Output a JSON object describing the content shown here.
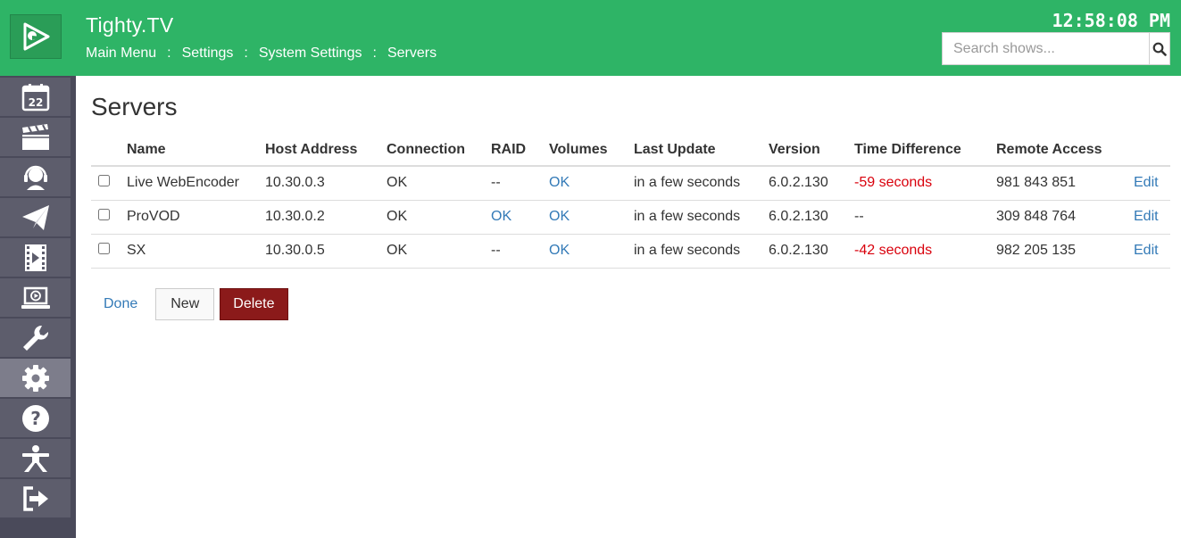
{
  "header": {
    "app_title": "Tighty.TV",
    "clock": "12:58:08 PM",
    "breadcrumb": [
      "Main Menu",
      "Settings",
      "System Settings",
      "Servers"
    ],
    "breadcrumb_separator": ":",
    "search_placeholder": "Search shows..."
  },
  "sidebar": {
    "calendar_day": "22",
    "icons": [
      "calendar-icon",
      "clapperboard-icon",
      "headset-icon",
      "paper-plane-icon",
      "film-icon",
      "laptop-play-icon",
      "wrench-icon",
      "gear-icon",
      "help-icon",
      "accessibility-icon",
      "logout-icon"
    ],
    "active_index": 7
  },
  "main": {
    "title": "Servers",
    "columns": [
      "",
      "Name",
      "Host Address",
      "Connection",
      "RAID",
      "Volumes",
      "Last Update",
      "Version",
      "Time Difference",
      "Remote Access",
      ""
    ],
    "rows": [
      {
        "name": "Live WebEncoder",
        "host": "10.30.0.3",
        "connection": "OK",
        "raid": "--",
        "volumes": "OK",
        "last_update": "in a few seconds",
        "version": "6.0.2.130",
        "time_diff": "-59 seconds",
        "remote_access": "981 843 851",
        "edit": "Edit"
      },
      {
        "name": "ProVOD",
        "host": "10.30.0.2",
        "connection": "OK",
        "raid": "OK",
        "volumes": "OK",
        "last_update": "in a few seconds",
        "version": "6.0.2.130",
        "time_diff": "--",
        "remote_access": "309 848 764",
        "edit": "Edit"
      },
      {
        "name": "SX",
        "host": "10.30.0.5",
        "connection": "OK",
        "raid": "--",
        "volumes": "OK",
        "last_update": "in a few seconds",
        "version": "6.0.2.130",
        "time_diff": "-42 seconds",
        "remote_access": "982 205 135",
        "edit": "Edit"
      }
    ],
    "buttons": {
      "done": "Done",
      "new": "New",
      "delete": "Delete"
    }
  },
  "colors": {
    "brand_green": "#2eb466",
    "sidebar_bg": "#4a4a5a",
    "link_blue": "#337ab7",
    "error_red": "#d9000c",
    "delete_red": "#8b1a1a"
  }
}
